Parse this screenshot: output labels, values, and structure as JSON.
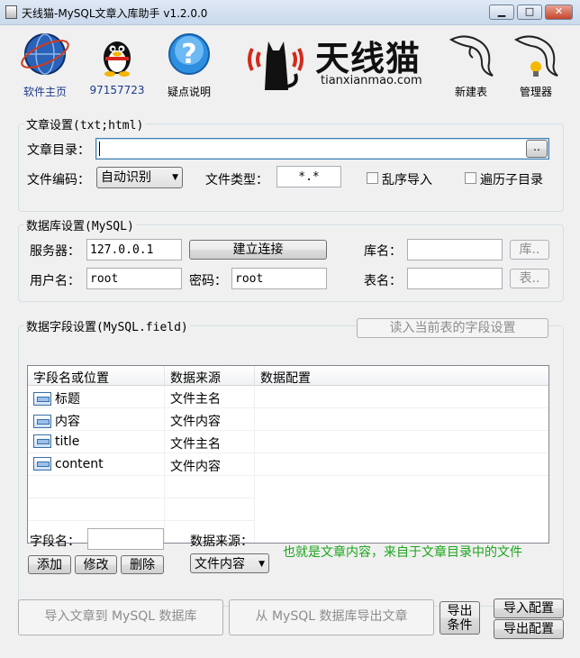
{
  "window": {
    "title": "天线猫-MySQL文章入库助手 v1.2.0.0",
    "minimize": "▁",
    "maximize": "□",
    "close": "✕"
  },
  "toolbar": {
    "home": "软件主页",
    "qq": "97157723",
    "help": "疑点说明",
    "new_table": "新建表",
    "manager": "管理器"
  },
  "logo": {
    "text": "天线猫",
    "domain": "tianxianmao.com"
  },
  "article": {
    "group_title": "文章设置(txt;html)",
    "dir_label": "文章目录：",
    "dir_value": "",
    "browse": "..",
    "encoding_label": "文件编码：",
    "encoding_value": "自动识别",
    "type_label": "文件类型：",
    "type_value": "*.*",
    "shuffle_label": "乱序导入",
    "recurse_label": "遍历子目录"
  },
  "db": {
    "group_title": "数据库设置(MySQL)",
    "server_label": "服务器：",
    "server_value": "127.0.0.1",
    "connect": "建立连接",
    "dbname_label": "库名：",
    "dbname_value": "",
    "dbname_btn": "库..",
    "user_label": "用户名：",
    "user_value": "root",
    "pass_label": "密码：",
    "pass_value": "root",
    "table_label": "表名：",
    "table_value": "",
    "table_btn": "表.."
  },
  "fields": {
    "group_title": "数据字段设置(MySQL.field)",
    "read_btn": "读入当前表的字段设置",
    "columns": [
      "字段名或位置",
      "数据来源",
      "数据配置"
    ],
    "rows": [
      {
        "name": "标题",
        "source": "文件主名",
        "config": ""
      },
      {
        "name": "内容",
        "source": "文件内容",
        "config": ""
      },
      {
        "name": "title",
        "source": "文件主名",
        "config": ""
      },
      {
        "name": "content",
        "source": "文件内容",
        "config": ""
      }
    ],
    "field_name_label": "字段名：",
    "field_name_value": "",
    "source_label": "数据来源：",
    "source_value": "文件内容",
    "add": "添加",
    "edit": "修改",
    "delete": "删除",
    "hint": "也就是文章内容，来自于文章目录中的文件"
  },
  "actions": {
    "import": "导入文章到 MySQL 数据库",
    "export": "从 MySQL 数据库导出文章",
    "export_cond": "导出条件",
    "import_cfg": "导入配置",
    "export_cfg": "导出配置"
  },
  "colors": {
    "accent": "#1c3a8a",
    "hint": "#1aa51a",
    "logo_red": "#d22a1d",
    "titlebar": "#c9d9ec"
  }
}
